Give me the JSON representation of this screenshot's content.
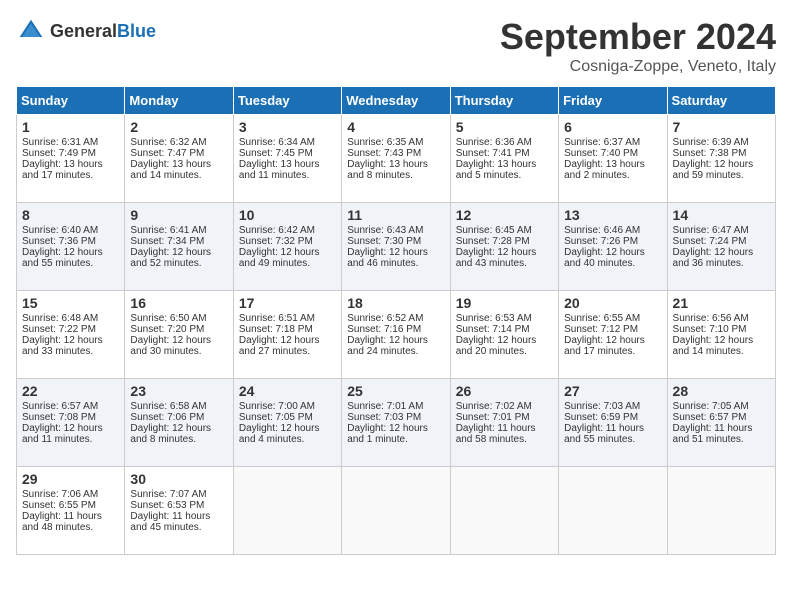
{
  "header": {
    "logo_general": "General",
    "logo_blue": "Blue",
    "month_title": "September 2024",
    "location": "Cosniga-Zoppe, Veneto, Italy"
  },
  "weekdays": [
    "Sunday",
    "Monday",
    "Tuesday",
    "Wednesday",
    "Thursday",
    "Friday",
    "Saturday"
  ],
  "weeks": [
    [
      {
        "day": "1",
        "sunrise": "Sunrise: 6:31 AM",
        "sunset": "Sunset: 7:49 PM",
        "daylight": "Daylight: 13 hours and 17 minutes."
      },
      {
        "day": "2",
        "sunrise": "Sunrise: 6:32 AM",
        "sunset": "Sunset: 7:47 PM",
        "daylight": "Daylight: 13 hours and 14 minutes."
      },
      {
        "day": "3",
        "sunrise": "Sunrise: 6:34 AM",
        "sunset": "Sunset: 7:45 PM",
        "daylight": "Daylight: 13 hours and 11 minutes."
      },
      {
        "day": "4",
        "sunrise": "Sunrise: 6:35 AM",
        "sunset": "Sunset: 7:43 PM",
        "daylight": "Daylight: 13 hours and 8 minutes."
      },
      {
        "day": "5",
        "sunrise": "Sunrise: 6:36 AM",
        "sunset": "Sunset: 7:41 PM",
        "daylight": "Daylight: 13 hours and 5 minutes."
      },
      {
        "day": "6",
        "sunrise": "Sunrise: 6:37 AM",
        "sunset": "Sunset: 7:40 PM",
        "daylight": "Daylight: 13 hours and 2 minutes."
      },
      {
        "day": "7",
        "sunrise": "Sunrise: 6:39 AM",
        "sunset": "Sunset: 7:38 PM",
        "daylight": "Daylight: 12 hours and 59 minutes."
      }
    ],
    [
      {
        "day": "8",
        "sunrise": "Sunrise: 6:40 AM",
        "sunset": "Sunset: 7:36 PM",
        "daylight": "Daylight: 12 hours and 55 minutes."
      },
      {
        "day": "9",
        "sunrise": "Sunrise: 6:41 AM",
        "sunset": "Sunset: 7:34 PM",
        "daylight": "Daylight: 12 hours and 52 minutes."
      },
      {
        "day": "10",
        "sunrise": "Sunrise: 6:42 AM",
        "sunset": "Sunset: 7:32 PM",
        "daylight": "Daylight: 12 hours and 49 minutes."
      },
      {
        "day": "11",
        "sunrise": "Sunrise: 6:43 AM",
        "sunset": "Sunset: 7:30 PM",
        "daylight": "Daylight: 12 hours and 46 minutes."
      },
      {
        "day": "12",
        "sunrise": "Sunrise: 6:45 AM",
        "sunset": "Sunset: 7:28 PM",
        "daylight": "Daylight: 12 hours and 43 minutes."
      },
      {
        "day": "13",
        "sunrise": "Sunrise: 6:46 AM",
        "sunset": "Sunset: 7:26 PM",
        "daylight": "Daylight: 12 hours and 40 minutes."
      },
      {
        "day": "14",
        "sunrise": "Sunrise: 6:47 AM",
        "sunset": "Sunset: 7:24 PM",
        "daylight": "Daylight: 12 hours and 36 minutes."
      }
    ],
    [
      {
        "day": "15",
        "sunrise": "Sunrise: 6:48 AM",
        "sunset": "Sunset: 7:22 PM",
        "daylight": "Daylight: 12 hours and 33 minutes."
      },
      {
        "day": "16",
        "sunrise": "Sunrise: 6:50 AM",
        "sunset": "Sunset: 7:20 PM",
        "daylight": "Daylight: 12 hours and 30 minutes."
      },
      {
        "day": "17",
        "sunrise": "Sunrise: 6:51 AM",
        "sunset": "Sunset: 7:18 PM",
        "daylight": "Daylight: 12 hours and 27 minutes."
      },
      {
        "day": "18",
        "sunrise": "Sunrise: 6:52 AM",
        "sunset": "Sunset: 7:16 PM",
        "daylight": "Daylight: 12 hours and 24 minutes."
      },
      {
        "day": "19",
        "sunrise": "Sunrise: 6:53 AM",
        "sunset": "Sunset: 7:14 PM",
        "daylight": "Daylight: 12 hours and 20 minutes."
      },
      {
        "day": "20",
        "sunrise": "Sunrise: 6:55 AM",
        "sunset": "Sunset: 7:12 PM",
        "daylight": "Daylight: 12 hours and 17 minutes."
      },
      {
        "day": "21",
        "sunrise": "Sunrise: 6:56 AM",
        "sunset": "Sunset: 7:10 PM",
        "daylight": "Daylight: 12 hours and 14 minutes."
      }
    ],
    [
      {
        "day": "22",
        "sunrise": "Sunrise: 6:57 AM",
        "sunset": "Sunset: 7:08 PM",
        "daylight": "Daylight: 12 hours and 11 minutes."
      },
      {
        "day": "23",
        "sunrise": "Sunrise: 6:58 AM",
        "sunset": "Sunset: 7:06 PM",
        "daylight": "Daylight: 12 hours and 8 minutes."
      },
      {
        "day": "24",
        "sunrise": "Sunrise: 7:00 AM",
        "sunset": "Sunset: 7:05 PM",
        "daylight": "Daylight: 12 hours and 4 minutes."
      },
      {
        "day": "25",
        "sunrise": "Sunrise: 7:01 AM",
        "sunset": "Sunset: 7:03 PM",
        "daylight": "Daylight: 12 hours and 1 minute."
      },
      {
        "day": "26",
        "sunrise": "Sunrise: 7:02 AM",
        "sunset": "Sunset: 7:01 PM",
        "daylight": "Daylight: 11 hours and 58 minutes."
      },
      {
        "day": "27",
        "sunrise": "Sunrise: 7:03 AM",
        "sunset": "Sunset: 6:59 PM",
        "daylight": "Daylight: 11 hours and 55 minutes."
      },
      {
        "day": "28",
        "sunrise": "Sunrise: 7:05 AM",
        "sunset": "Sunset: 6:57 PM",
        "daylight": "Daylight: 11 hours and 51 minutes."
      }
    ],
    [
      {
        "day": "29",
        "sunrise": "Sunrise: 7:06 AM",
        "sunset": "Sunset: 6:55 PM",
        "daylight": "Daylight: 11 hours and 48 minutes."
      },
      {
        "day": "30",
        "sunrise": "Sunrise: 7:07 AM",
        "sunset": "Sunset: 6:53 PM",
        "daylight": "Daylight: 11 hours and 45 minutes."
      },
      null,
      null,
      null,
      null,
      null
    ]
  ]
}
